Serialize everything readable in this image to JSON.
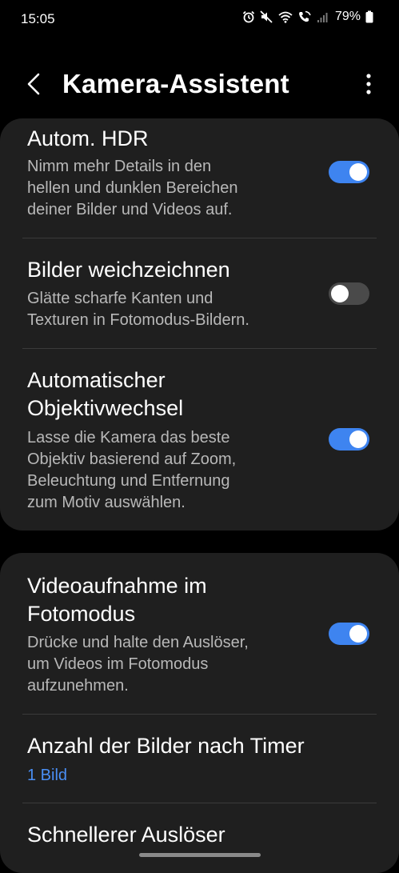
{
  "status_bar": {
    "time": "15:05",
    "battery_percent": "79%",
    "icons": [
      "alarm-icon",
      "mute-icon",
      "wifi-icon",
      "wifi-calling-icon",
      "signal-icon",
      "battery-icon"
    ]
  },
  "app_bar": {
    "title": "Kamera-Assistent",
    "back_icon": "chevron-left-icon",
    "menu_icon": "more-vertical-icon"
  },
  "card1": {
    "items": [
      {
        "title": "Autom. HDR",
        "subtitle": "Nimm mehr Details in den hellen und dunklen Bereichen deiner Bilder und Videos auf.",
        "subtitle_lines": [
          "Nimm mehr Details in den",
          "hellen und dunklen Bereichen",
          "deiner Bilder und Videos auf."
        ],
        "enabled": true
      },
      {
        "title": "Bilder weichzeichnen",
        "subtitle_lines": [
          "Glätte scharfe Kanten und",
          "Texturen in Fotomodus-Bildern."
        ],
        "enabled": false
      },
      {
        "title_lines": [
          "Automatischer",
          "Objektivwechsel"
        ],
        "subtitle_lines": [
          "Lasse die Kamera das beste",
          "Objektiv basierend auf Zoom,",
          "Beleuchtung und Entfernung",
          "zum Motiv auswählen."
        ],
        "enabled": true
      }
    ]
  },
  "card2": {
    "items": [
      {
        "title_lines": [
          "Videoaufnahme im",
          "Fotomodus"
        ],
        "subtitle_lines": [
          "Drücke und halte den Auslöser,",
          "um Videos im Fotomodus",
          "aufzunehmen."
        ],
        "enabled": true
      },
      {
        "title": "Anzahl der Bilder nach Timer",
        "value": "1 Bild"
      },
      {
        "title": "Schnellerer Auslöser"
      }
    ]
  },
  "colors": {
    "background": "#000000",
    "card": "#1f1f1f",
    "accent": "#3e84f0",
    "value_text": "#4a8ff5",
    "secondary_text": "#b8b8b8"
  }
}
